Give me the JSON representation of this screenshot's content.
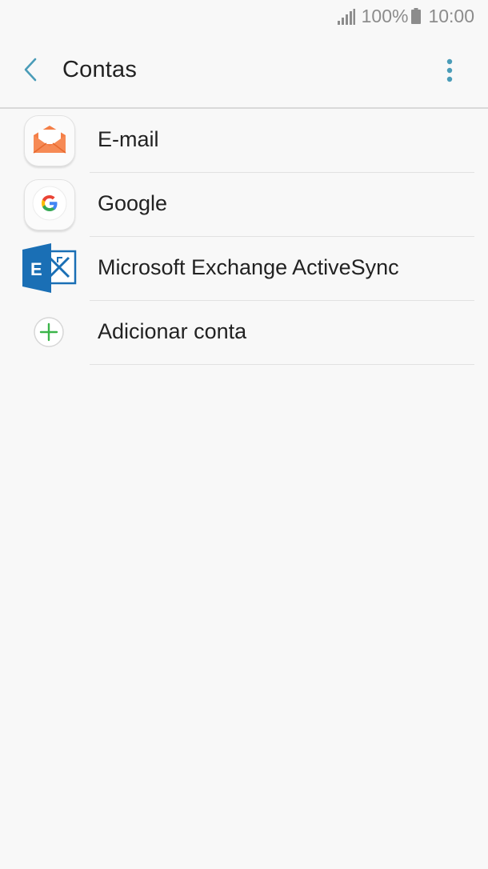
{
  "status_bar": {
    "battery_percent": "100%",
    "time": "10:00",
    "icons": [
      "signal-icon",
      "battery-icon"
    ]
  },
  "app_bar": {
    "title": "Contas",
    "icons": [
      "back-arrow-icon",
      "more-vert-icon"
    ],
    "accent_color": "#4a9cb8"
  },
  "accounts": [
    {
      "label": "E-mail",
      "icon": "email-icon"
    },
    {
      "label": "Google",
      "icon": "google-icon"
    },
    {
      "label": "Microsoft Exchange ActiveSync",
      "icon": "exchange-icon"
    },
    {
      "label": "Adicionar conta",
      "icon": "add-icon"
    }
  ],
  "colors": {
    "background": "#f8f8f8",
    "email_icon": "#f47e46",
    "exchange_icon": "#1a6fb5",
    "add_icon": "#3bb54a"
  }
}
